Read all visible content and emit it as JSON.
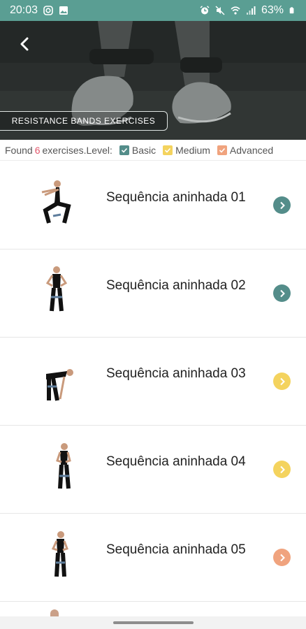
{
  "status_bar": {
    "time": "20:03",
    "battery": "63%"
  },
  "header": {
    "title": "RESISTANCE BANDS EXERCISES"
  },
  "filter": {
    "prefix": "Found",
    "count": "6",
    "suffix": "exercises.Level:",
    "levels": [
      {
        "label": "Basic",
        "color": "#548d8a"
      },
      {
        "label": "Medium",
        "color": "#f4d35e"
      },
      {
        "label": "Advanced",
        "color": "#f0a37e"
      }
    ]
  },
  "exercises": [
    {
      "title": "Sequência aninhada 01",
      "color": "#548d8a",
      "pose": "squat"
    },
    {
      "title": "Sequência aninhada 02",
      "color": "#548d8a",
      "pose": "stand"
    },
    {
      "title": "Sequência aninhada 03",
      "color": "#f4d35e",
      "pose": "bend"
    },
    {
      "title": "Sequência aninhada 04",
      "color": "#f4d35e",
      "pose": "stand"
    },
    {
      "title": "Sequência aninhada 05",
      "color": "#f0a37e",
      "pose": "stand"
    }
  ]
}
